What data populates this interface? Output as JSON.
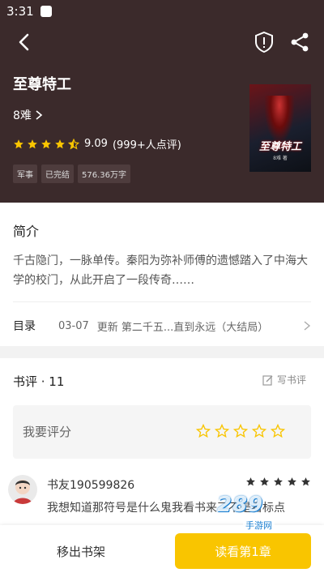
{
  "status_bar": {
    "time": "3:31"
  },
  "book": {
    "title": "至尊特工",
    "author": "8难",
    "rating": "9.09",
    "rating_count": "(999+人点评)",
    "stars": 4.5,
    "tags": [
      "军事",
      "已完结",
      "576.36万字"
    ],
    "cover_title": "至尊特工",
    "cover_author": "8难 著"
  },
  "intro": {
    "title": "简介",
    "text": "千古隐门，一脉单传。秦阳为弥补师傅的遗憾踏入了中海大学的校门，从此开启了一段传奇……"
  },
  "toc": {
    "label": "目录",
    "date": "03-07",
    "update": "更新  第二千五...直到永远（大结局）"
  },
  "reviews": {
    "header": "书评 · 11",
    "write_label": "写书评",
    "rate_label": "我要评分",
    "comment": {
      "user": "书友190599826",
      "stars": 5,
      "text": "我想知道那符号是什么鬼我看书来了不是看标点"
    }
  },
  "bottom": {
    "remove_shelf": "移出书架",
    "read_button": "读看第1章"
  },
  "watermark": {
    "logo": "289",
    "site": "手游网"
  },
  "colors": {
    "header_bg": "#3b2a2b",
    "accent": "#f9c500",
    "star": "#f9c500"
  }
}
